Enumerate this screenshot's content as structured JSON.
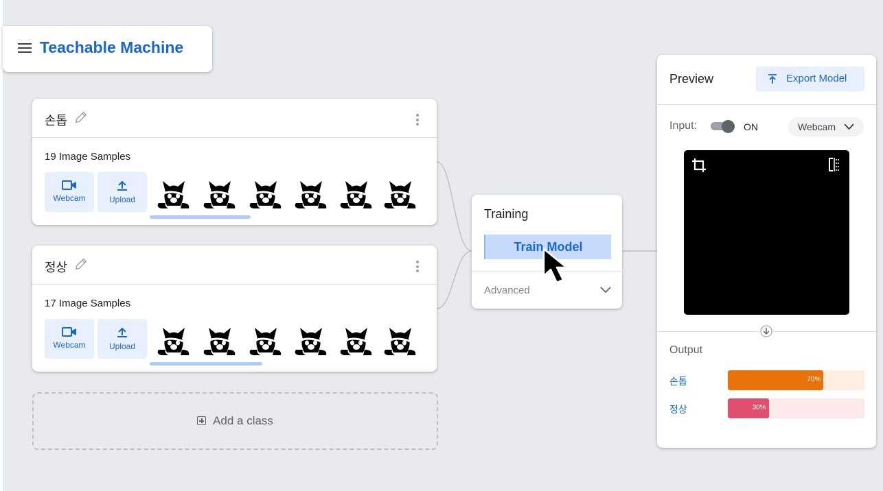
{
  "app": {
    "title": "Teachable Machine"
  },
  "classes": [
    {
      "name": "손톱",
      "samples_text": "19 Image Samples",
      "webcam_label": "Webcam",
      "upload_label": "Upload"
    },
    {
      "name": "정상",
      "samples_text": "17 Image Samples",
      "webcam_label": "Webcam",
      "upload_label": "Upload"
    }
  ],
  "add_class": {
    "label": "Add a class"
  },
  "training": {
    "title": "Training",
    "train_button": "Train Model",
    "advanced_label": "Advanced"
  },
  "preview": {
    "title": "Preview",
    "export_button": "Export Model",
    "input_label": "Input:",
    "toggle_state": "ON",
    "source_select": "Webcam",
    "output_title": "Output",
    "outputs": [
      {
        "label": "손톱",
        "percent": 70,
        "percent_text": "70%",
        "fill_color": "#e8710a",
        "track_color": "#fdeee1"
      },
      {
        "label": "정상",
        "percent": 30,
        "percent_text": "30%",
        "fill_color": "#e0506e",
        "track_color": "#fde8ea"
      }
    ]
  },
  "colors": {
    "accent": "#1967d2",
    "background": "#e8eaed"
  },
  "icons": [
    "menu-icon",
    "pencil-icon",
    "more-vert-icon",
    "video-camera-icon",
    "upload-icon",
    "cat-image-icon",
    "add-box-icon",
    "chevron-down-icon",
    "export-icon",
    "crop-icon",
    "flip-icon",
    "arrow-down-icon",
    "mouse-cursor-icon"
  ]
}
